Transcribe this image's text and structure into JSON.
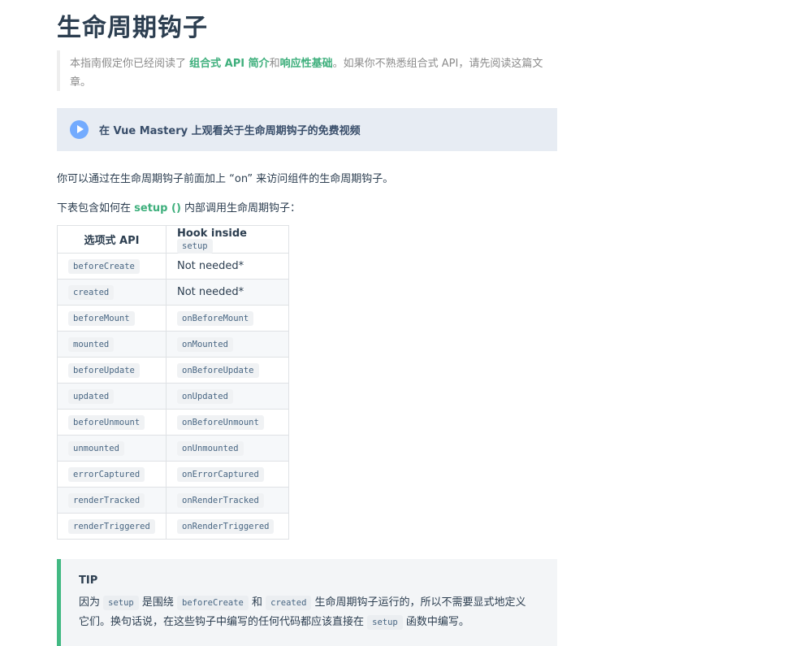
{
  "page": {
    "title": "生命周期钩子"
  },
  "intro": {
    "text_before": "本指南假定你已经阅读了 ",
    "link1": "组合式 API 简介",
    "text_and": "和",
    "link2": "响应性基础",
    "text_after": "。如果你不熟悉组合式 API，请先阅读这篇文",
    "text_line2": "章。"
  },
  "banner": {
    "icon": "play-icon",
    "label": "在 Vue Mastery 上观看关于生命周期钩子的免费视频",
    "icon_color": "#73abfe",
    "background": "#e7ecf3"
  },
  "paragraphs": {
    "p1": "你可以通过在生命周期钩子前面加上 “on” 来访问组件的生命周期钩子。",
    "p2_before": "下表包含如何在 ",
    "p2_link": "setup ()",
    "p2_after": " 内部调用生命周期钩子："
  },
  "table": {
    "headers": {
      "col1": "选项式 API",
      "col2_text": "Hook inside",
      "col2_code": "setup"
    },
    "rows": [
      {
        "option": "beforeCreate",
        "hook": "Not needed*"
      },
      {
        "option": "created",
        "hook": "Not needed*"
      },
      {
        "option": "beforeMount",
        "hook": "onBeforeMount"
      },
      {
        "option": "mounted",
        "hook": "onMounted"
      },
      {
        "option": "beforeUpdate",
        "hook": "onBeforeUpdate"
      },
      {
        "option": "updated",
        "hook": "onUpdated"
      },
      {
        "option": "beforeUnmount",
        "hook": "onBeforeUnmount"
      },
      {
        "option": "unmounted",
        "hook": "onUnmounted"
      },
      {
        "option": "errorCaptured",
        "hook": "onErrorCaptured"
      },
      {
        "option": "renderTracked",
        "hook": "onRenderTracked"
      },
      {
        "option": "renderTriggered",
        "hook": "onRenderTriggered"
      }
    ]
  },
  "tip": {
    "title": "TIP",
    "t1": "因为 ",
    "c1": "setup",
    "t2": " 是围绕 ",
    "c2": "beforeCreate",
    "t3": " 和 ",
    "c3": "created",
    "t4": " 生命周期钩子运行的，所以不需要显式地定义",
    "t5": "它们。换句话说，在这些钩子中编写的任何代码都应该直接在 ",
    "c4": "setup",
    "t6": " 函数中编写。",
    "accent_color": "#42b983"
  }
}
